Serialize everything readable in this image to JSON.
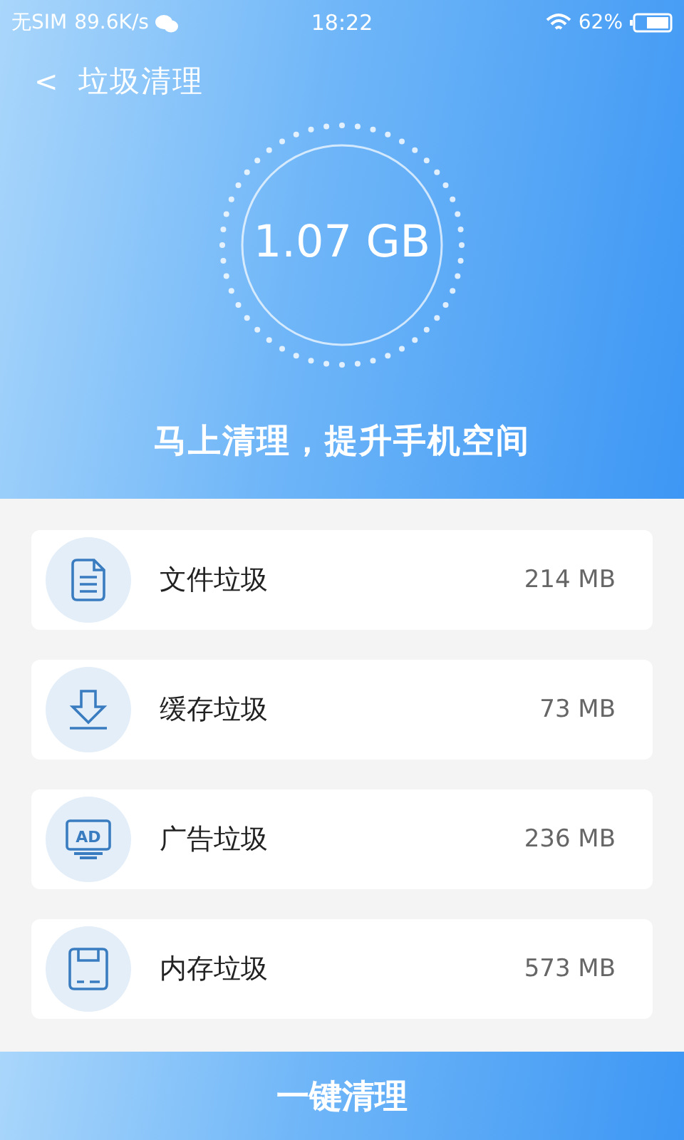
{
  "status_bar": {
    "carrier": "无SIM",
    "speed": "89.6K/s",
    "time": "18:22",
    "battery": "62%"
  },
  "header": {
    "back": "<",
    "title": "垃圾清理"
  },
  "summary": {
    "size": "1.07 GB",
    "caption": "马上清理，提升手机空间"
  },
  "items": [
    {
      "kind": "file",
      "name": "文件垃圾",
      "size": "214 MB"
    },
    {
      "kind": "download",
      "name": "缓存垃圾",
      "size": "73 MB"
    },
    {
      "kind": "ad",
      "icon_text": "AD",
      "name": "广告垃圾",
      "size": "236 MB"
    },
    {
      "kind": "save",
      "name": "内存垃圾",
      "size": "573 MB"
    }
  ],
  "action_button": "一键清理"
}
